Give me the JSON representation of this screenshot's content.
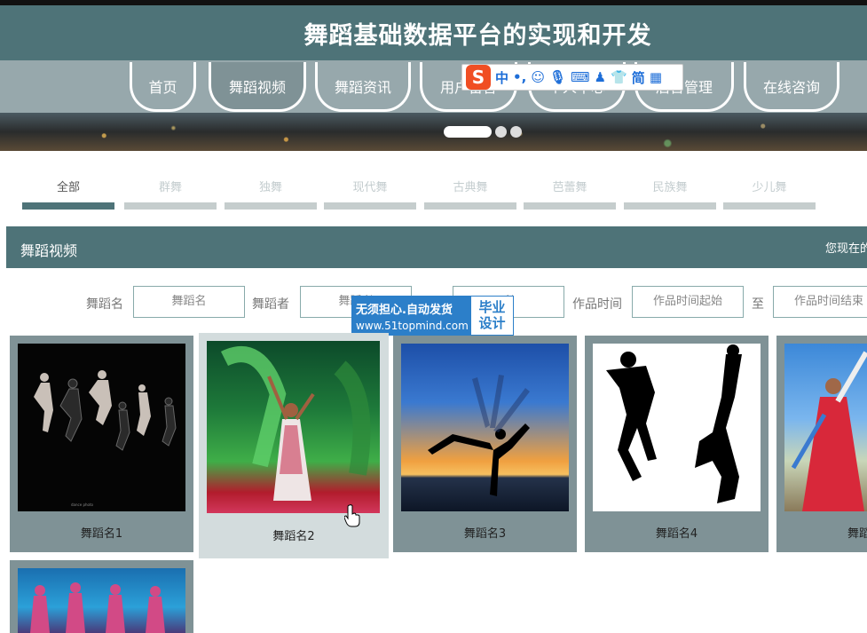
{
  "header": {
    "title": "舞蹈基础数据平台的实现和开发"
  },
  "nav": {
    "items": [
      {
        "label": "首页"
      },
      {
        "label": "舞蹈视频"
      },
      {
        "label": "舞蹈资讯"
      },
      {
        "label": "用户留言"
      },
      {
        "label": "个人中心"
      },
      {
        "label": "后台管理"
      },
      {
        "label": "在线咨询"
      }
    ],
    "active_index": 1
  },
  "ime_toolbar": {
    "logo": "S",
    "mode": "中",
    "punct": "•,",
    "simplified": "简"
  },
  "categories": {
    "items": [
      "全部",
      "群舞",
      "独舞",
      "现代舞",
      "古典舞",
      "芭蕾舞",
      "民族舞",
      "少儿舞"
    ],
    "active_index": 0
  },
  "section": {
    "title": "舞蹈视频",
    "location": "您现在的"
  },
  "search": {
    "name_label": "舞蹈名",
    "name_placeholder": "舞蹈名",
    "dancer_label": "舞蹈者",
    "dancer_placeholder": "舞蹈者",
    "third_placeholder": "者",
    "time_label": "作品时间",
    "time_start_placeholder": "作品时间起始",
    "to_label": "至",
    "time_end_placeholder": "作品时间结束"
  },
  "ad": {
    "line1": "无须担心.自动发货",
    "line2": "www.51topmind.com",
    "badge1": "毕业",
    "badge2": "设计"
  },
  "cards": [
    {
      "name": "舞蹈名1"
    },
    {
      "name": "舞蹈名2"
    },
    {
      "name": "舞蹈名3"
    },
    {
      "name": "舞蹈名4"
    },
    {
      "name": "舞蹈"
    },
    {
      "name": ""
    }
  ],
  "colors": {
    "primary": "#4e7378",
    "card": "#7f9296",
    "nav_strip": "#97a8ac"
  }
}
